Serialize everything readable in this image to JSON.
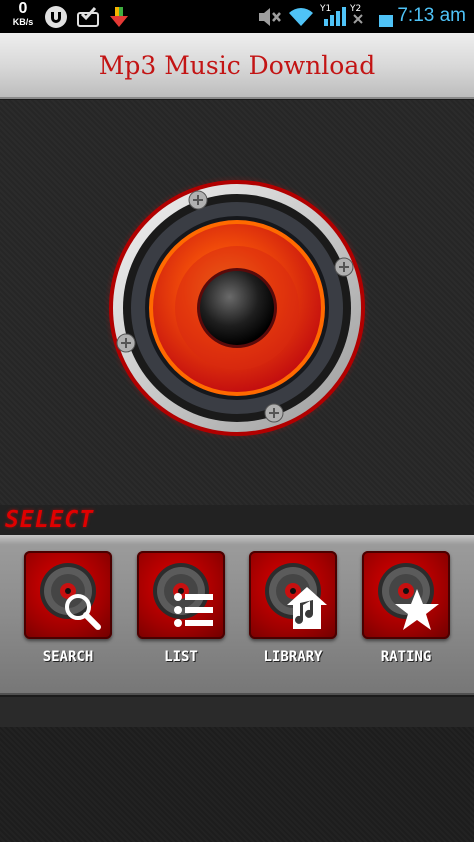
{
  "status_bar": {
    "speed_value": "0",
    "speed_unit": "KB/s",
    "time": "7:13 am",
    "icons": [
      "utorrent-icon",
      "inbox-check-icon",
      "download-arrow-icon",
      "mute-icon",
      "wifi-icon",
      "signal-icon",
      "signal-x-icon",
      "battery-icon"
    ]
  },
  "header": {
    "title": "Mp3 Music Download"
  },
  "main": {
    "image": "speaker-icon"
  },
  "select_section": {
    "label": "SELECT",
    "buttons": [
      {
        "label": "SEARCH",
        "icon": "magnifier-icon"
      },
      {
        "label": "LIST",
        "icon": "list-icon"
      },
      {
        "label": "LIBRARY",
        "icon": "music-house-icon"
      },
      {
        "label": "RATING",
        "icon": "star-icon"
      }
    ]
  },
  "colors": {
    "title_red": "#c31414",
    "accent_red": "#e00000",
    "clock_blue": "#4fc3f7"
  }
}
